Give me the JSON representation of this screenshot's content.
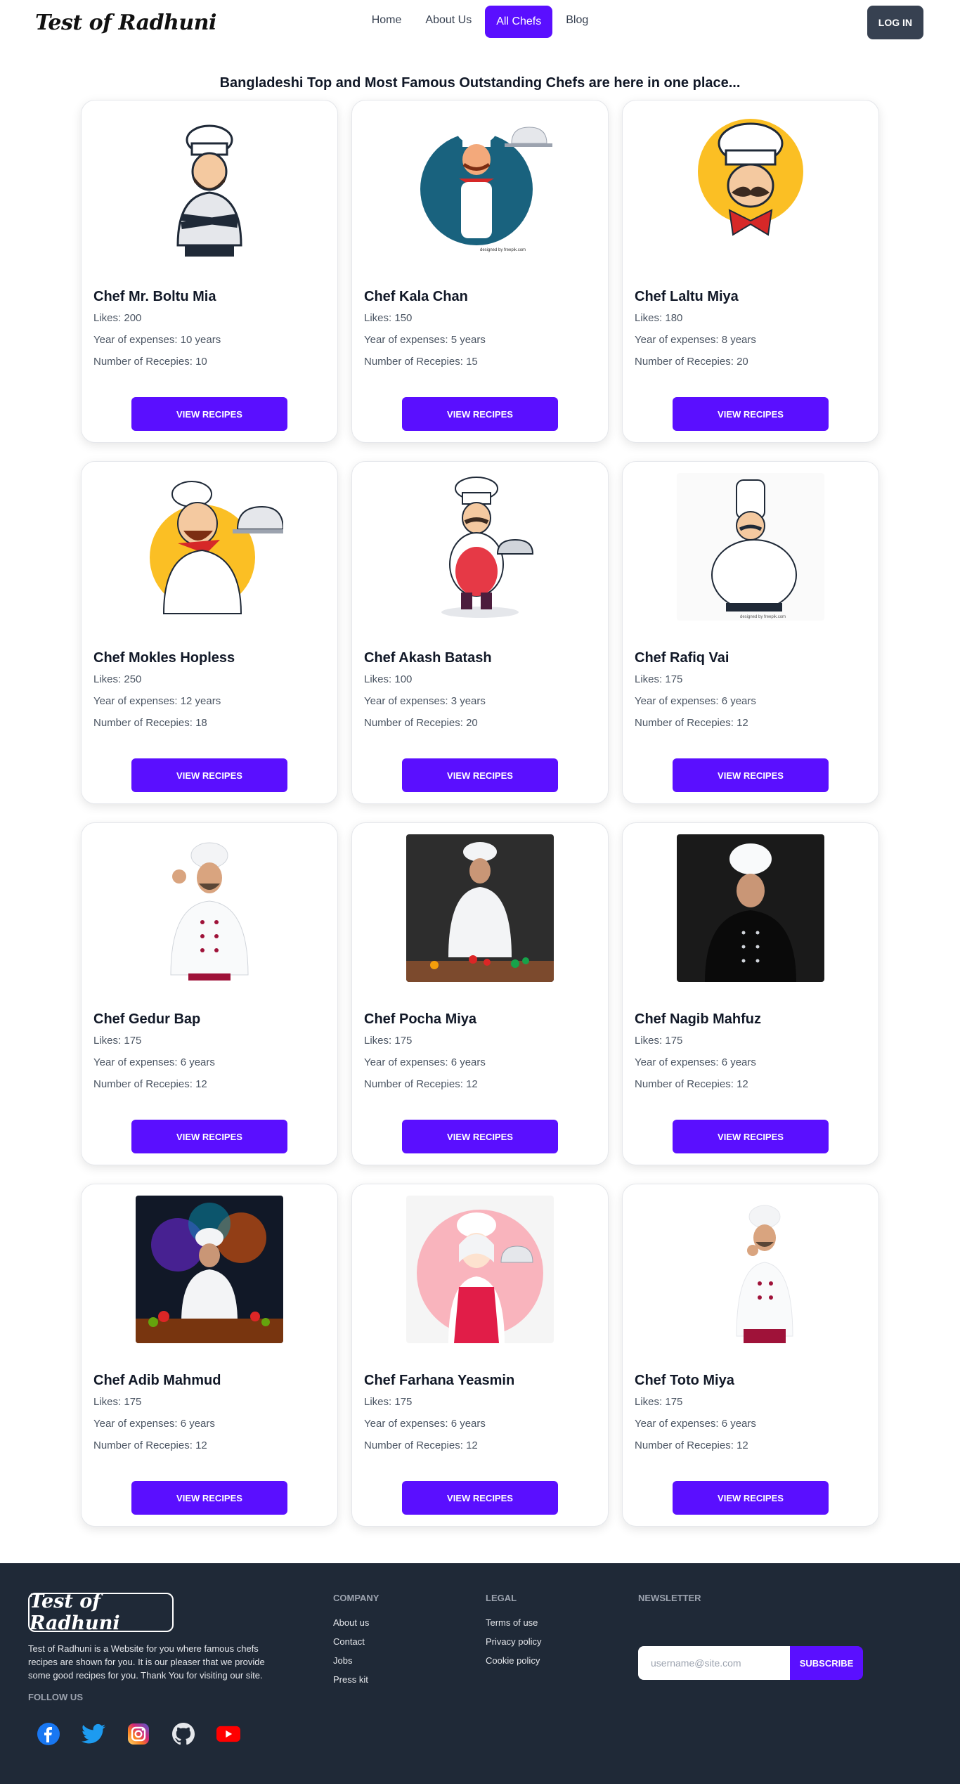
{
  "nav": {
    "logo": "Test of Radhuni",
    "links": [
      "Home",
      "About Us",
      "All Chefs",
      "Blog"
    ],
    "active_link": "All Chefs",
    "login_label": "LOG IN"
  },
  "headline": "Bangladeshi Top and Most Famous Outstanding Chefs are here in one place...",
  "labels": {
    "likes": "Likes:",
    "experience": "Year of expenses:",
    "recipes": "Number of Recepies:",
    "years_unit": "years",
    "view_button": "VIEW RECIPES"
  },
  "chefs": [
    {
      "name": "Chef Mr. Boltu Mia",
      "likes": "Likes: 200",
      "experience": "Year of expenses: 10 years",
      "recipes": "Number of Recepies: 10",
      "image": "cartoon-chef-arms-crossed"
    },
    {
      "name": "Chef Kala Chan",
      "likes": "Likes: 150",
      "experience": "Year of expenses: 5 years",
      "recipes": "Number of Recepies: 15",
      "image": "cartoon-chef-cloche-blue-circle"
    },
    {
      "name": "Chef Laltu Miya",
      "likes": "Likes: 180",
      "experience": "Year of expenses: 8 years",
      "recipes": "Number of Recepies: 20",
      "image": "cartoon-chef-mustache-yellow-circle"
    },
    {
      "name": "Chef Mokles Hopless",
      "likes": "Likes: 250",
      "experience": "Year of expenses: 12 years",
      "recipes": "Number of Recepies: 18",
      "image": "cartoon-chef-cloche-yellow"
    },
    {
      "name": "Chef Akash Batash",
      "likes": "Likes: 100",
      "experience": "Year of expenses: 3 years",
      "recipes": "Number of Recepies: 20",
      "image": "cartoon-chef-red-apron"
    },
    {
      "name": "Chef Rafiq Vai",
      "likes": "Likes: 175",
      "experience": "Year of expenses: 6 years",
      "recipes": "Number of Recepies: 12",
      "image": "cartoon-chef-big-belly"
    },
    {
      "name": "Chef Gedur Bap",
      "likes": "Likes: 175",
      "experience": "Year of expenses: 6 years",
      "recipes": "Number of Recepies: 12",
      "image": "photo-chef-ok-sign"
    },
    {
      "name": "Chef Pocha Miya",
      "likes": "Likes: 175",
      "experience": "Year of expenses: 6 years",
      "recipes": "Number of Recepies: 12",
      "image": "photo-chef-cutting-vegetables"
    },
    {
      "name": "Chef Nagib Mahfuz",
      "likes": "Likes: 175",
      "experience": "Year of expenses: 6 years",
      "recipes": "Number of Recepies: 12",
      "image": "photo-chef-black-jacket"
    },
    {
      "name": "Chef Adib Mahmud",
      "likes": "Likes: 175",
      "experience": "Year of expenses: 6 years",
      "recipes": "Number of Recepies: 12",
      "image": "photo-chef-colorful-kitchen"
    },
    {
      "name": "Chef Farhana Yeasmin",
      "likes": "Likes: 175",
      "experience": "Year of expenses: 6 years",
      "recipes": "Number of Recepies: 12",
      "image": "cartoon-female-chef-pink-circle"
    },
    {
      "name": "Chef Toto Miya",
      "likes": "Likes: 175",
      "experience": "Year of expenses: 6 years",
      "recipes": "Number of Recepies: 12",
      "image": "photo-chef-thinking"
    }
  ],
  "footer": {
    "logo": "Test of Radhuni",
    "description": "Test of Radhuni is a Website for you where famous chefs recipes are shown for you. It is our pleaser that we provide some good recipes for you. Thank You for visiting our site.",
    "follow_title": "FOLLOW US",
    "social": [
      "facebook-icon",
      "twitter-icon",
      "instagram-icon",
      "github-icon",
      "youtube-icon"
    ],
    "company": {
      "title": "COMPANY",
      "links": [
        "About us",
        "Contact",
        "Jobs",
        "Press kit"
      ]
    },
    "legal": {
      "title": "LEGAL",
      "links": [
        "Terms of use",
        "Privacy policy",
        "Cookie policy"
      ]
    },
    "newsletter": {
      "title": "NEWSLETTER",
      "placeholder": "username@site.com",
      "button": "SUBSCRIBE"
    }
  },
  "colors": {
    "accent": "#5a0fff",
    "login": "#374151",
    "footer_bg": "#1f2937"
  }
}
